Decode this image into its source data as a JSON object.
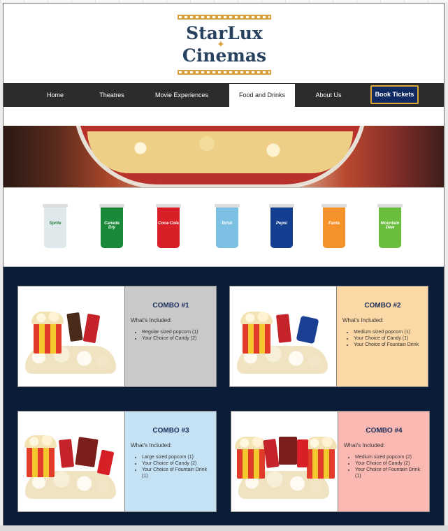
{
  "brand": {
    "line1": "StarLux",
    "line2": "Cinemas"
  },
  "nav": {
    "items": [
      {
        "label": "Home"
      },
      {
        "label": "Theatres"
      },
      {
        "label": "Movie Experiences"
      },
      {
        "label": "Food and Drinks"
      },
      {
        "label": "About Us"
      }
    ],
    "active": "Food and Drinks",
    "cta": "Book Tickets"
  },
  "drinks": [
    {
      "name": "Sprite",
      "color": "#dfe9ec"
    },
    {
      "name": "Canada Dry",
      "color": "#1a8a3a"
    },
    {
      "name": "Coca-Cola",
      "color": "#d81e26"
    },
    {
      "name": "Brisk",
      "color": "#7cc1e4"
    },
    {
      "name": "Pepsi",
      "color": "#143f91"
    },
    {
      "name": "Fanta",
      "color": "#f6922a"
    },
    {
      "name": "Mountain Dew",
      "color": "#6abd3d"
    }
  ],
  "combos": [
    {
      "title": "COMBO #1",
      "subtitle": "What's Included:",
      "items": [
        "Regular sized popcorn (1)",
        "Your Choice of Candy (2)"
      ],
      "color": "#c9c9c9"
    },
    {
      "title": "COMBO #2",
      "subtitle": "What's Included:",
      "items": [
        "Medium sized popcorn (1)",
        "Your Choice of Candy (1)",
        "Your Choice of Fountain Drink"
      ],
      "color": "#fcd8a6"
    },
    {
      "title": "COMBO #3",
      "subtitle": "What's Included:",
      "items": [
        "Large sized popcorn (1)",
        "Your Choice of Candy (2)",
        "Your Choice of Fountain Drink (1)"
      ],
      "color": "#c4e2f4"
    },
    {
      "title": "COMBO #4",
      "subtitle": "What's Included:",
      "items": [
        "Medium sized popcorn (2)",
        "Your Choice of Candy (2)",
        "Your Choice of Fountain Drink (1)"
      ],
      "color": "#fbb9b3"
    }
  ],
  "colors": {
    "nav_bg": "#2c2c2c",
    "section_bg": "#0b1c38",
    "gold": "#d9a63a",
    "cta_bg": "#0f2a62"
  }
}
